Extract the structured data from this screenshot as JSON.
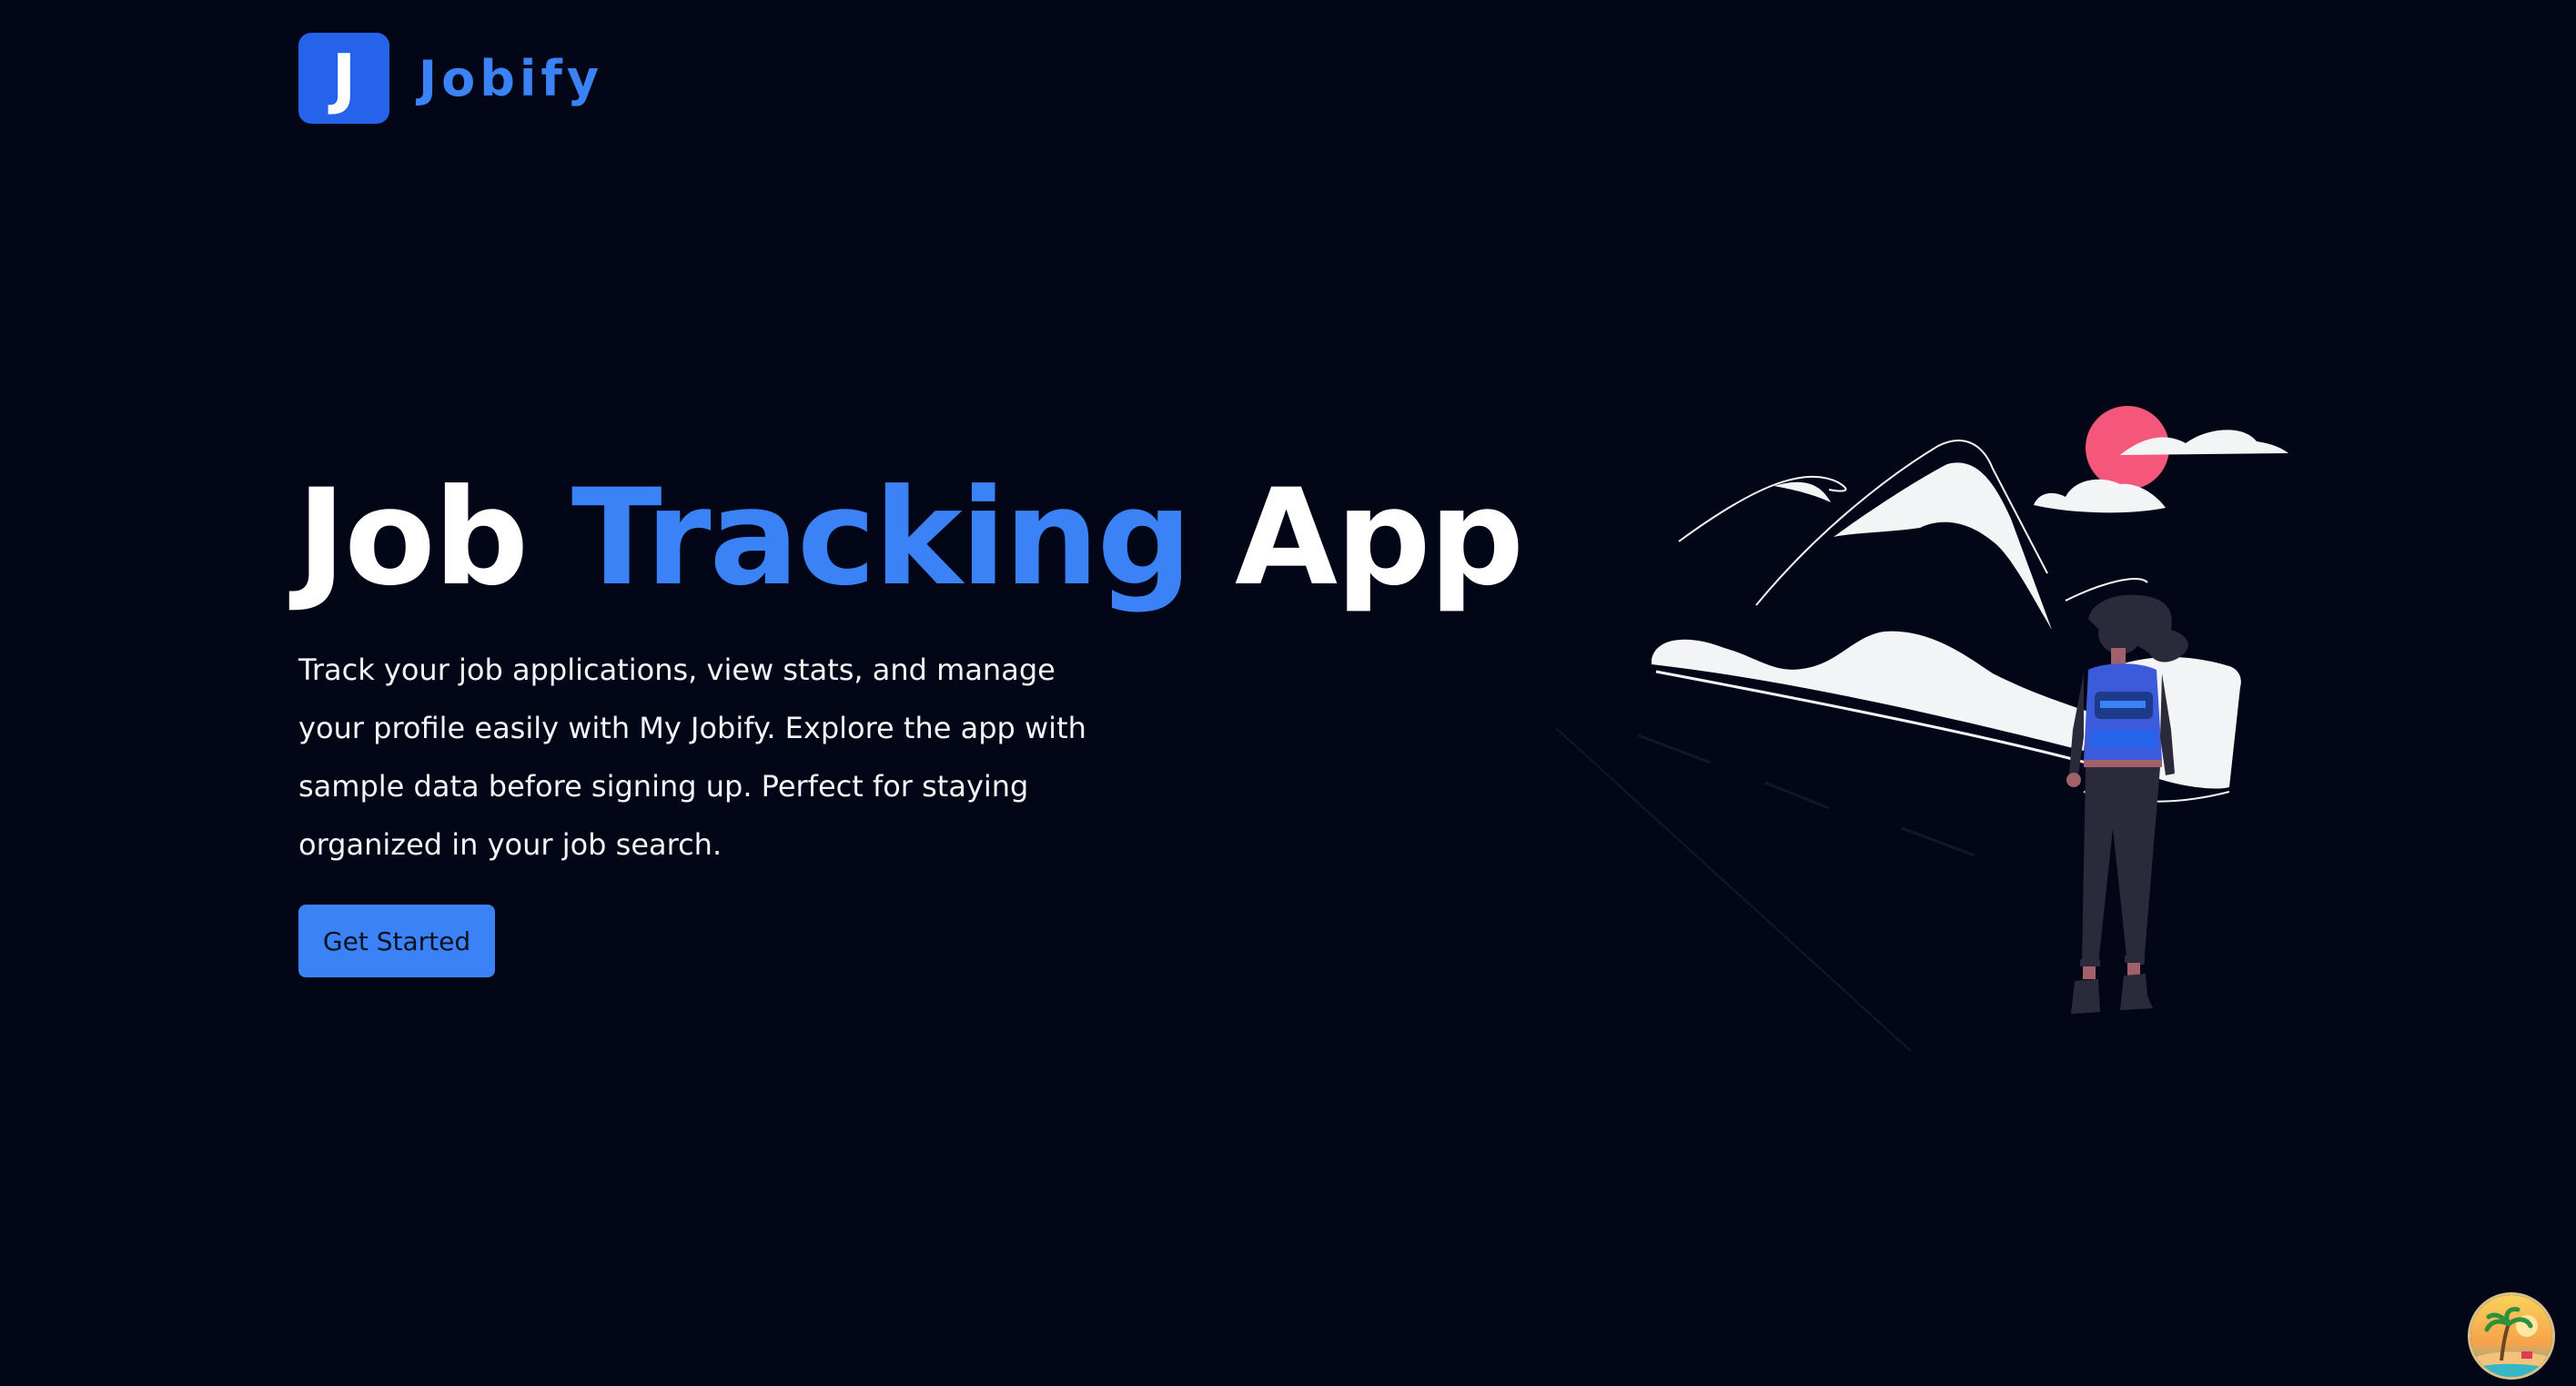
{
  "nav": {
    "logo_letter": "J",
    "brand": "Jobify"
  },
  "hero": {
    "title_part1": "Job",
    "title_accent": "Tracking",
    "title_part2": "App",
    "description": "Track your job applications, view stats, and manage your profile easily with My Jobify. Explore the app with sample data before signing up. Perfect for staying organized in your job search.",
    "cta_label": "Get Started"
  },
  "colors": {
    "background": "#030617",
    "accent": "#3b82f6",
    "logo_bg": "#2563eb",
    "sun": "#f4577a",
    "figure_outfit": "#2b2a3a"
  },
  "icons": {
    "hero_image": "woman-mountains-illustration",
    "corner": "beach-palm-avatar-icon"
  }
}
